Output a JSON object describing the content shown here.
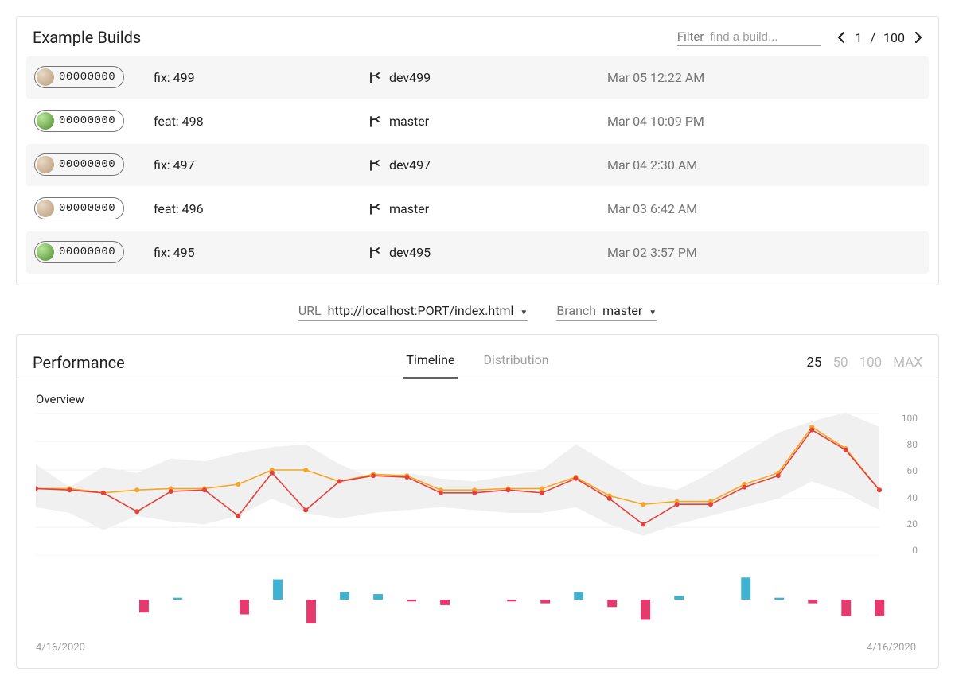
{
  "builds_card": {
    "title": "Example Builds",
    "filter_label": "Filter",
    "filter_placeholder": "find a build...",
    "pager": {
      "current": "1",
      "sep": "/",
      "total": "100"
    },
    "rows": [
      {
        "hash": "00000000",
        "avatar": "a",
        "msg": "fix: 499",
        "branch": "dev499",
        "time": "Mar 05 12:22 AM"
      },
      {
        "hash": "00000000",
        "avatar": "b",
        "msg": "feat: 498",
        "branch": "master",
        "time": "Mar 04 10:09 PM"
      },
      {
        "hash": "00000000",
        "avatar": "a",
        "msg": "fix: 497",
        "branch": "dev497",
        "time": "Mar 04 2:30 AM"
      },
      {
        "hash": "00000000",
        "avatar": "a",
        "msg": "feat: 496",
        "branch": "master",
        "time": "Mar 03 6:42 AM"
      },
      {
        "hash": "00000000",
        "avatar": "b",
        "msg": "fix: 495",
        "branch": "dev495",
        "time": "Mar 02 3:57 PM"
      }
    ]
  },
  "selectors": {
    "url": {
      "label": "URL",
      "value": "http://localhost:PORT/index.html"
    },
    "branch": {
      "label": "Branch",
      "value": "master"
    }
  },
  "perf_card": {
    "title": "Performance",
    "tabs": {
      "timeline": "Timeline",
      "distribution": "Distribution",
      "active": "timeline"
    },
    "ranges": [
      "25",
      "50",
      "100",
      "MAX"
    ],
    "active_range": "25",
    "overview_label": "Overview",
    "date_start": "4/16/2020",
    "date_end": "4/16/2020"
  },
  "chart_data": {
    "overview": {
      "type": "line",
      "ylim": [
        0,
        100
      ],
      "yticks": [
        100,
        80,
        60,
        40,
        20,
        0
      ],
      "n": 25,
      "series": [
        {
          "name": "band_upper",
          "color_fill": "#ededed",
          "values": [
            64,
            48,
            62,
            58,
            68,
            66,
            72,
            76,
            78,
            64,
            54,
            58,
            54,
            52,
            56,
            60,
            78,
            64,
            50,
            46,
            58,
            72,
            86,
            94,
            100,
            90
          ]
        },
        {
          "name": "band_lower",
          "color_fill": "#ededed",
          "values": [
            34,
            30,
            18,
            28,
            24,
            22,
            28,
            40,
            30,
            26,
            30,
            32,
            34,
            32,
            30,
            30,
            34,
            22,
            14,
            22,
            28,
            34,
            40,
            52,
            44,
            32
          ]
        },
        {
          "name": "orange",
          "color": "#f6a623",
          "values": [
            47,
            47,
            44,
            46,
            47,
            47,
            50,
            60,
            60,
            52,
            57,
            56,
            46,
            46,
            47,
            47,
            55,
            42,
            36,
            38,
            38,
            50,
            58,
            90,
            75,
            46
          ]
        },
        {
          "name": "red",
          "color": "#e5413c",
          "values": [
            47,
            46,
            44,
            31,
            45,
            46,
            28,
            58,
            32,
            52,
            56,
            55,
            44,
            44,
            46,
            44,
            54,
            40,
            22,
            36,
            36,
            48,
            56,
            88,
            74,
            46
          ]
        }
      ]
    },
    "diff_bars": {
      "type": "bar",
      "n": 25,
      "range": [
        -30,
        30
      ],
      "colors": {
        "pos": "#3eb2d0",
        "neg": "#e6396d"
      },
      "values": [
        0,
        0,
        0,
        -14,
        2,
        0,
        -16,
        22,
        -26,
        8,
        6,
        -2,
        -6,
        0,
        -2,
        -4,
        8,
        -8,
        -22,
        4,
        0,
        24,
        2,
        -4,
        -18,
        -18
      ]
    }
  }
}
